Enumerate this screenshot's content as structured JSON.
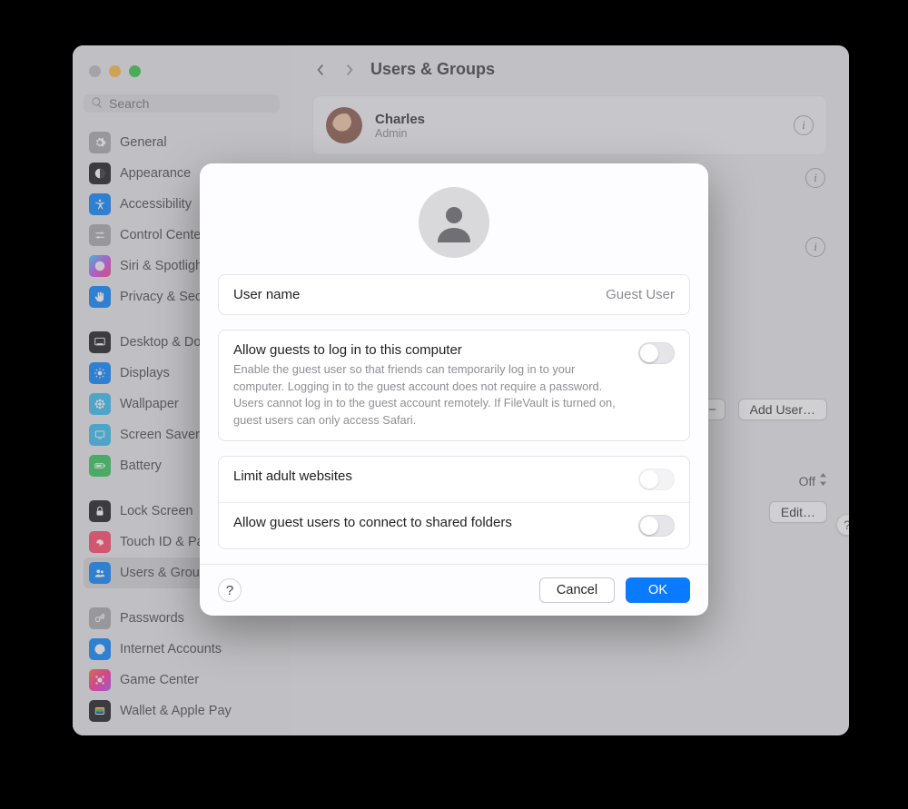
{
  "header": {
    "title": "Users & Groups"
  },
  "search": {
    "placeholder": "Search"
  },
  "sidebar": {
    "group1": [
      {
        "label": "General",
        "bg": "#a9a9ad",
        "icon": "gear"
      },
      {
        "label": "Appearance",
        "bg": "#1d1d1f",
        "icon": "appearance"
      },
      {
        "label": "Accessibility",
        "bg": "#0a84ff",
        "icon": "accessibility"
      },
      {
        "label": "Control Center",
        "bg": "#a9a9ad",
        "icon": "sliders"
      },
      {
        "label": "Siri & Spotlight",
        "bg": "linear-gradient(135deg,#2fd6ff,#c355f2,#ff3b74)",
        "icon": "siri"
      },
      {
        "label": "Privacy & Security",
        "bg": "#0a84ff",
        "icon": "hand"
      }
    ],
    "group2": [
      {
        "label": "Desktop & Dock",
        "bg": "#1d1d1f",
        "icon": "dock"
      },
      {
        "label": "Displays",
        "bg": "#0a84ff",
        "icon": "sun"
      },
      {
        "label": "Wallpaper",
        "bg": "#3abdf0",
        "icon": "flower"
      },
      {
        "label": "Screen Saver",
        "bg": "#3abdf0",
        "icon": "screensaver"
      },
      {
        "label": "Battery",
        "bg": "#34c759",
        "icon": "battery"
      }
    ],
    "group3": [
      {
        "label": "Lock Screen",
        "bg": "#1d1d1f",
        "icon": "lock"
      },
      {
        "label": "Touch ID & Password",
        "bg": "#ff4568",
        "icon": "fingerprint"
      },
      {
        "label": "Users & Groups",
        "bg": "#0a84ff",
        "icon": "users",
        "selected": true
      }
    ],
    "group4": [
      {
        "label": "Passwords",
        "bg": "#a9a9ad",
        "icon": "key"
      },
      {
        "label": "Internet Accounts",
        "bg": "#0a84ff",
        "icon": "at"
      },
      {
        "label": "Game Center",
        "bg": "linear-gradient(135deg,#ff6a3d,#ff2d92,#b549ff)",
        "icon": "gc"
      },
      {
        "label": "Wallet & Apple Pay",
        "bg": "#1d1d1f",
        "icon": "wallet"
      }
    ]
  },
  "main": {
    "user": {
      "name": "Charles",
      "role": "Admin"
    },
    "add_user": "Add User…",
    "auto_off": "Off",
    "edit": "Edit…"
  },
  "modal": {
    "username_label": "User name",
    "username_value": "Guest User",
    "allow_login": {
      "title": "Allow guests to log in to this computer",
      "desc": "Enable the guest user so that friends can temporarily log in to your computer. Logging in to the guest account does not require a password. Users cannot log in to the guest account remotely. If FileVault is turned on, guest users can only access Safari."
    },
    "limit_adult": "Limit adult websites",
    "shared_folders": "Allow guest users to connect to shared folders",
    "cancel": "Cancel",
    "ok": "OK",
    "help": "?"
  }
}
